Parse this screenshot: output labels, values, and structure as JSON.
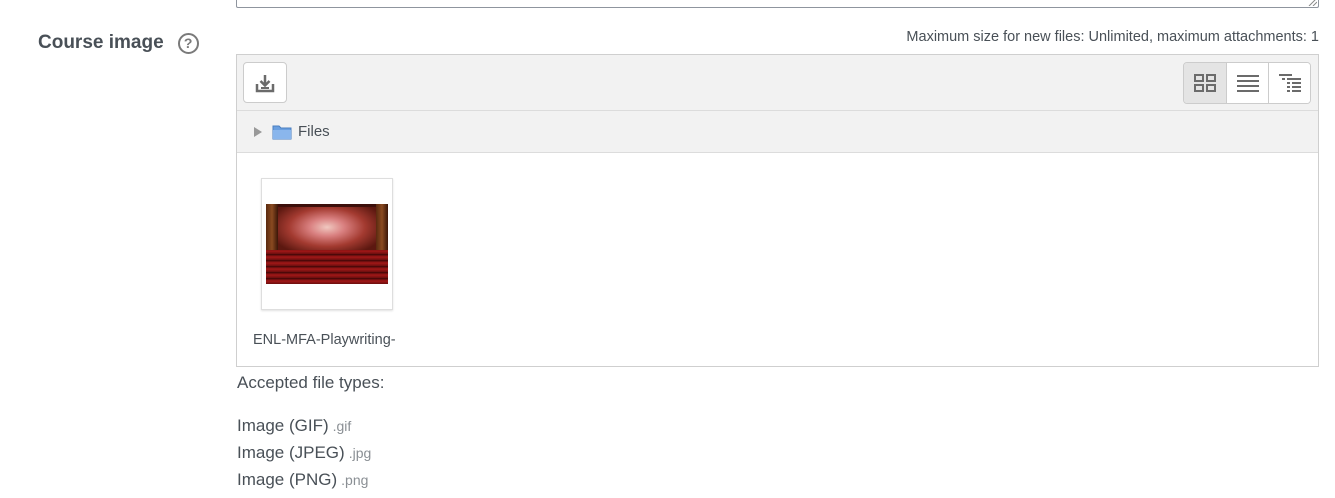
{
  "field": {
    "label": "Course image",
    "help_icon": "question-circle-icon"
  },
  "filemanager": {
    "max_size_text": "Maximum size for new files: Unlimited, maximum attachments: 1",
    "add_button_icon": "download-icon",
    "view_buttons": [
      {
        "name": "thumbnails",
        "icon": "grid-icon"
      },
      {
        "name": "list",
        "icon": "list-icon"
      },
      {
        "name": "tree",
        "icon": "tree-icon"
      }
    ],
    "path_label": "Files",
    "files": [
      {
        "name": "ENL-MFA-Playwriting-"
      }
    ]
  },
  "accepted": {
    "title": "Accepted file types:",
    "types": [
      {
        "label": "Image (GIF)",
        "ext": ".gif"
      },
      {
        "label": "Image (JPEG)",
        "ext": ".jpg"
      },
      {
        "label": "Image (PNG)",
        "ext": ".png"
      }
    ]
  },
  "colors": {
    "text": "#495057",
    "toolbar_bg": "#f2f2f2",
    "border": "#cfcfcf",
    "folder_blue": "#6a9fe0"
  }
}
